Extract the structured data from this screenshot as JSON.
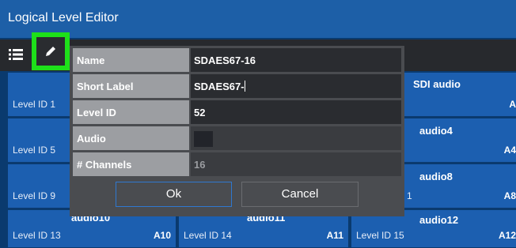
{
  "window": {
    "title": "Logical Level Editor"
  },
  "tiles": {
    "level1": {
      "label": "Level ID 1"
    },
    "level5": {
      "label": "Level ID 5"
    },
    "level9": {
      "label": "Level ID 9"
    },
    "level13": {
      "label": "Level ID 13",
      "name": "audio10",
      "code": "A10"
    },
    "level14": {
      "label": "Level ID 14",
      "name": "audio11",
      "code": "A11"
    },
    "level15": {
      "label": "Level ID 15",
      "name": "audio12",
      "code": "A12"
    },
    "col3_row1": {
      "name": "SDI audio",
      "code": "A"
    },
    "col3_row2": {
      "name": "audio4",
      "code": "A4"
    },
    "col3_row3": {
      "name": "audio8",
      "code": "A8",
      "partial": "1"
    }
  },
  "dialog": {
    "fields": {
      "name": {
        "label": "Name",
        "value": "SDAES67-16"
      },
      "short_label": {
        "label": "Short Label",
        "value": "SDAES67-"
      },
      "level_id": {
        "label": "Level ID",
        "value": "52"
      },
      "audio": {
        "label": "Audio",
        "checked": false
      },
      "channels": {
        "label": "# Channels",
        "value": "16"
      }
    },
    "ok_label": "Ok",
    "cancel_label": "Cancel"
  },
  "colors": {
    "accent": "#1ee01a",
    "titlebar": "#1d5fa7",
    "tile": "#1c5fb0",
    "dialog": "#4a4c50"
  },
  "icons": [
    "list-icon",
    "edit-pencil-icon"
  ]
}
